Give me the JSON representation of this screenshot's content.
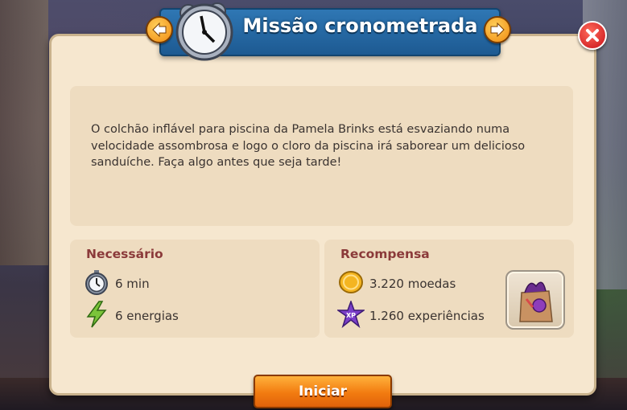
{
  "dialog": {
    "title": "Missão cronometrada",
    "description": "O colchão inflável para piscina da Pamela Brinks está esvaziando numa velocidade assombrosa e logo o cloro da piscina irá saborear um delicioso sanduíche. Faça algo antes que seja tarde!",
    "start_label": "Iniciar"
  },
  "requirements": {
    "title": "Necessário",
    "items": [
      {
        "icon": "stopwatch-icon",
        "label": "6 min"
      },
      {
        "icon": "energy-bolt-icon",
        "label": "6 energias"
      }
    ]
  },
  "rewards": {
    "title": "Recompensa",
    "items": [
      {
        "icon": "coin-icon",
        "label": "3.220 moedas"
      },
      {
        "icon": "xp-star-icon",
        "label": "1.260 experiências",
        "badge": "XP"
      }
    ],
    "item_reward_icon": "gift-bag-icon"
  },
  "colors": {
    "title_bar": "#2f77b4",
    "panel": "#f6e7cf",
    "section_title": "#8b3a3a",
    "start_button": "#f27b10"
  }
}
